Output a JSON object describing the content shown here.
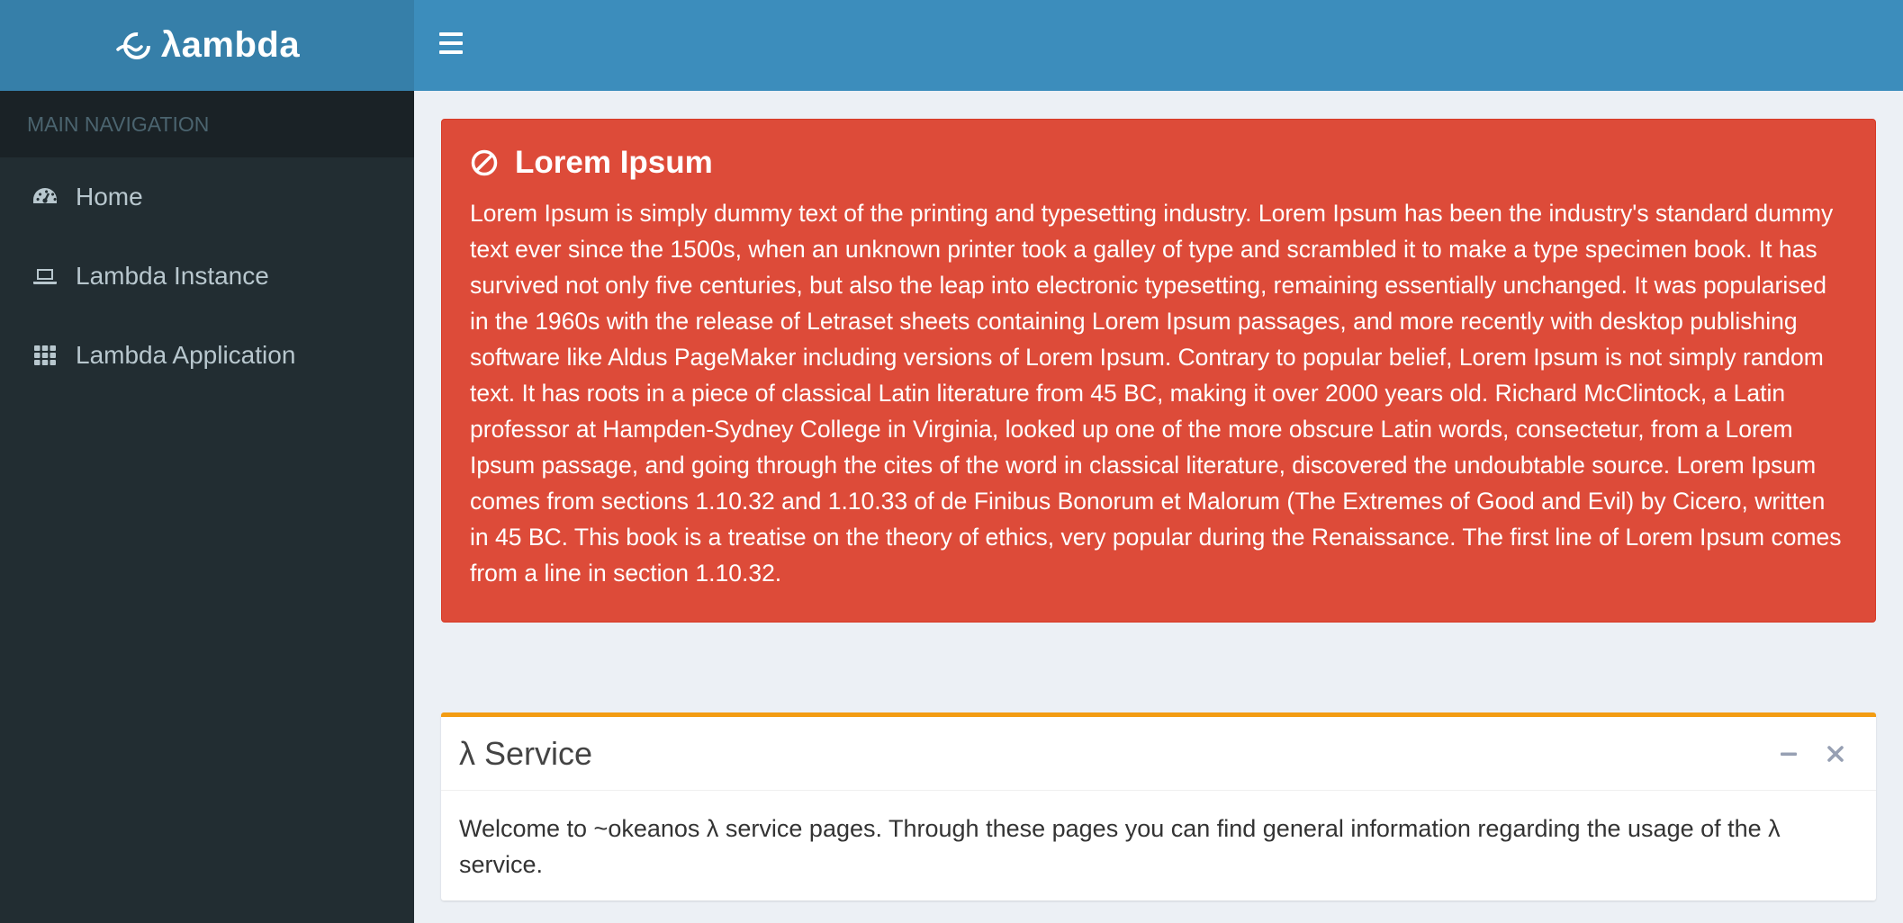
{
  "brand": {
    "name": "λambda"
  },
  "sidebar": {
    "header": "MAIN NAVIGATION",
    "items": [
      {
        "label": "Home",
        "icon": "dashboard-icon"
      },
      {
        "label": "Lambda Instance",
        "icon": "laptop-icon"
      },
      {
        "label": "Lambda Application",
        "icon": "grid-icon"
      }
    ]
  },
  "alert": {
    "title": "Lorem Ipsum",
    "icon": "ban-icon",
    "text": "Lorem Ipsum is simply dummy text of the printing and typesetting industry. Lorem Ipsum has been the industry's standard dummy text ever since the 1500s, when an unknown printer took a galley of type and scrambled it to make a type specimen book. It has survived not only five centuries, but also the leap into electronic typesetting, remaining essentially unchanged. It was popularised in the 1960s with the release of Letraset sheets containing Lorem Ipsum passages, and more recently with desktop publishing software like Aldus PageMaker including versions of Lorem Ipsum. Contrary to popular belief, Lorem Ipsum is not simply random text. It has roots in a piece of classical Latin literature from 45 BC, making it over 2000 years old. Richard McClintock, a Latin professor at Hampden-Sydney College in Virginia, looked up one of the more obscure Latin words, consectetur, from a Lorem Ipsum passage, and going through the cites of the word in classical literature, discovered the undoubtable source. Lorem Ipsum comes from sections 1.10.32 and 1.10.33 of de Finibus Bonorum et Malorum (The Extremes of Good and Evil) by Cicero, written in 45 BC. This book is a treatise on the theory of ethics, very popular during the Renaissance. The first line of Lorem Ipsum comes from a line in section 1.10.32."
  },
  "service_box": {
    "title": "λ Service",
    "body": "Welcome to ~okeanos λ service pages. Through these pages you can find general information regarding the usage of the λ service."
  },
  "colors": {
    "header_bg": "#3c8dbc",
    "logo_bg": "#367fa9",
    "sidebar_bg": "#222d32",
    "alert_bg": "#dd4b39",
    "box_accent": "#f39c12"
  }
}
